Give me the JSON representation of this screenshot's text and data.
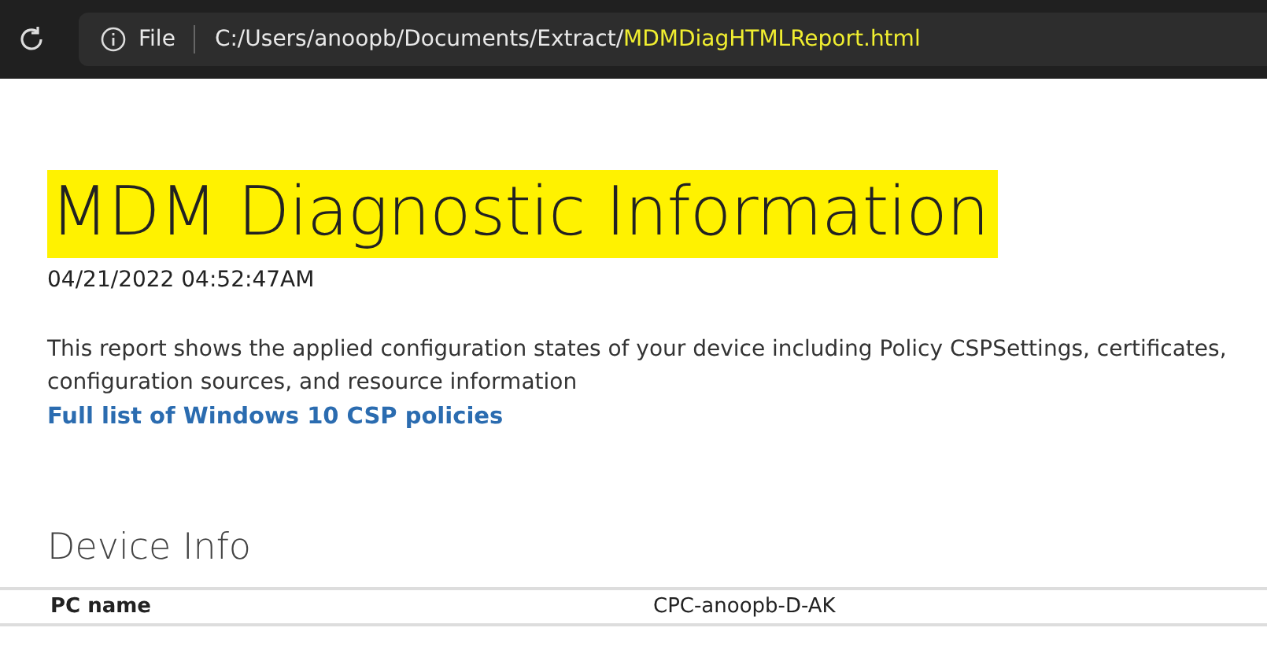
{
  "browser": {
    "info_label": "File",
    "address_path": "C:/Users/anoopb/Documents/Extract/",
    "address_file": {
      "text": "MDMDiagHTMLReport.html",
      "highlighted": true
    }
  },
  "report": {
    "title": {
      "text": "MDM Diagnostic Information",
      "highlighted": true
    },
    "timestamp": "04/21/2022 04:52:47AM",
    "description": "This report shows the applied configuration states of your device including Policy CSPSettings, certificates, configuration sources, and resource information",
    "link": "Full list of Windows 10 CSP policies"
  },
  "device_info": {
    "heading": "Device Info",
    "rows": [
      {
        "label": "PC name",
        "value": "CPC-anoopb-D-AK"
      }
    ]
  }
}
